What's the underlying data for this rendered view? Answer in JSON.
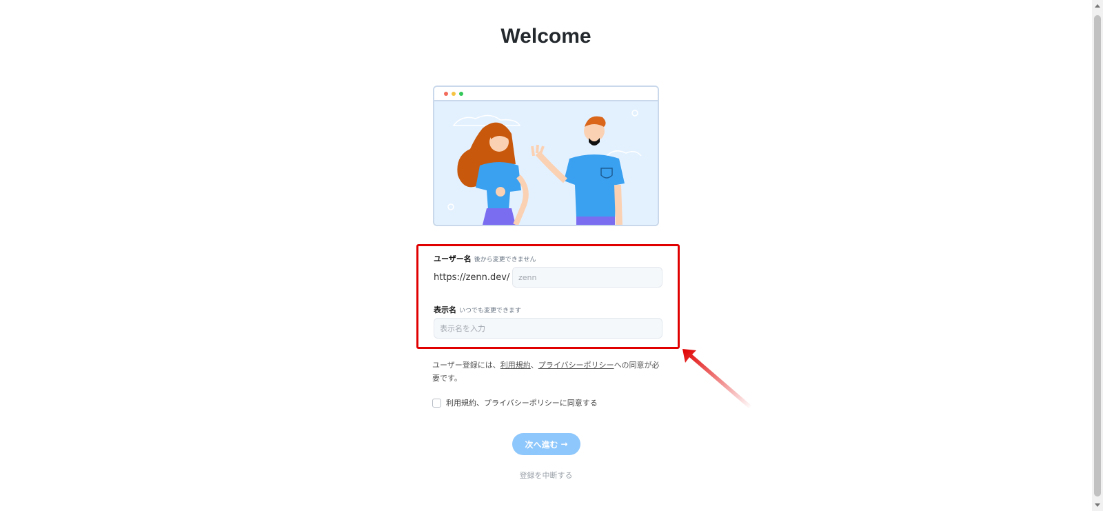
{
  "page": {
    "title": "Welcome"
  },
  "form": {
    "username": {
      "label": "ユーザー名",
      "hint": "後から変更できません",
      "prefix": "https://zenn.dev/",
      "placeholder": "zenn"
    },
    "display_name": {
      "label": "表示名",
      "hint": "いつでも変更できます",
      "placeholder": "表示名を入力"
    }
  },
  "agreement": {
    "text_before": "ユーザー登録には、",
    "terms_link": "利用規約",
    "separator": "、",
    "privacy_link": "プライバシーポリシー",
    "text_after": "への同意が必要です。",
    "checkbox_label": "利用規約、プライバシーポリシーに同意する"
  },
  "actions": {
    "next_label": "次へ進む",
    "next_arrow": "→",
    "cancel_label": "登録を中断する"
  },
  "colors": {
    "highlight_box": "#e00000",
    "button": "#8ec7fb",
    "illustration_bg": "#e3f1ff"
  }
}
